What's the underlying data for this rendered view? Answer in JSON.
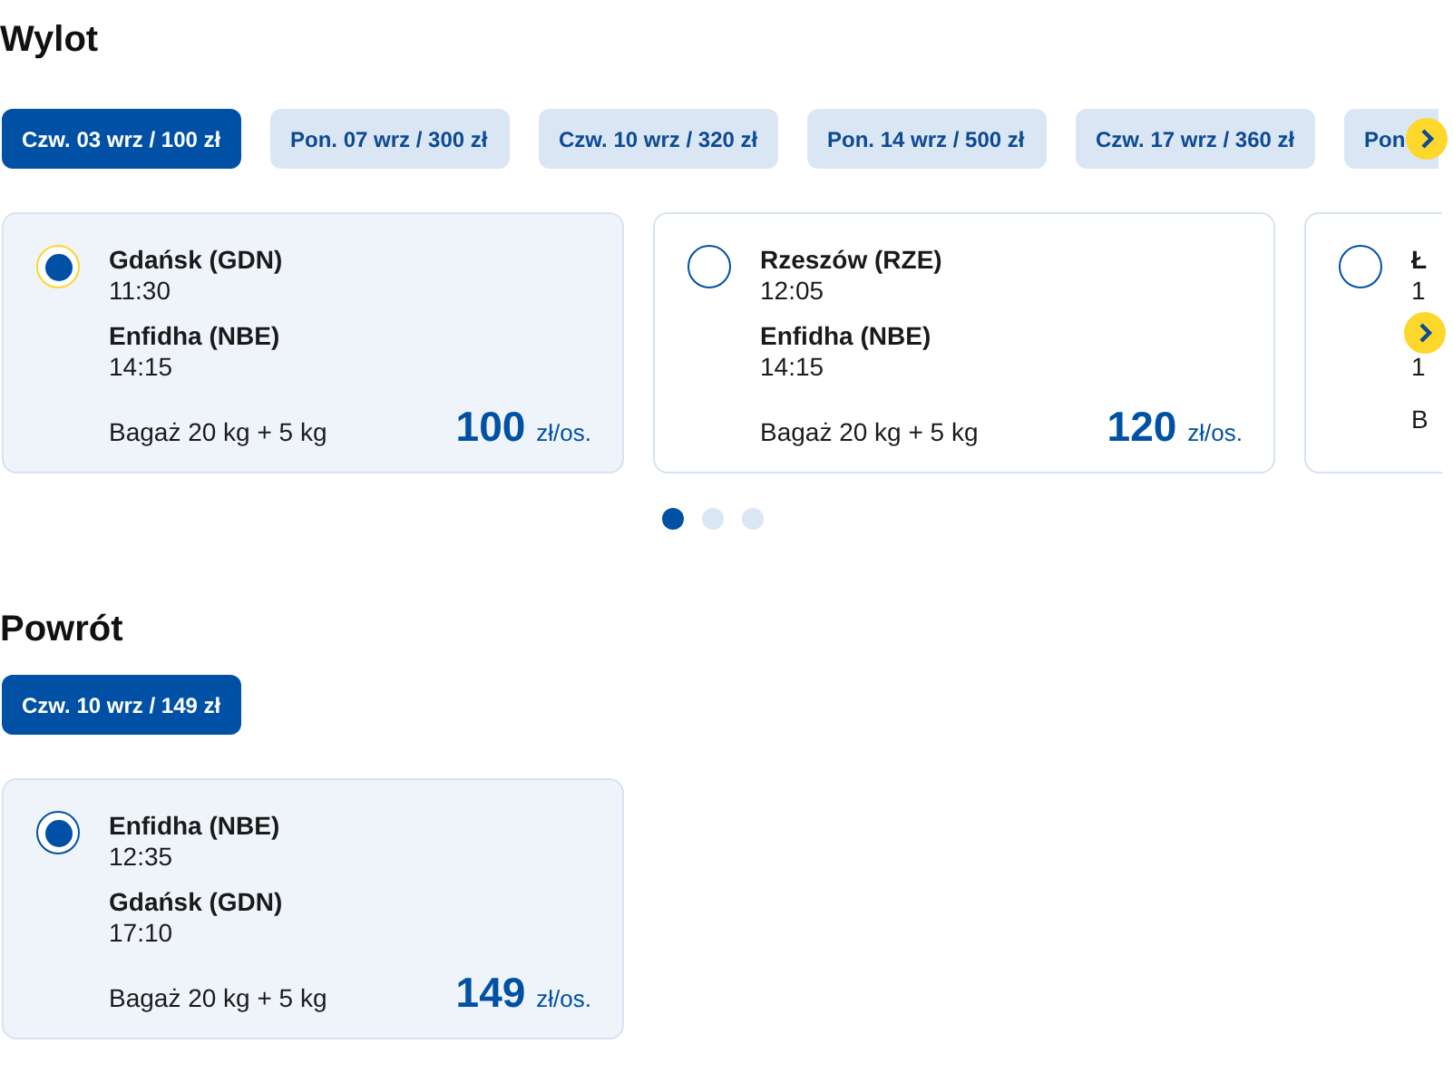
{
  "outbound": {
    "title": "Wylot",
    "dates": [
      {
        "label": "Czw. 03 wrz / 100 zł",
        "selected": true
      },
      {
        "label": "Pon. 07 wrz / 300 zł",
        "selected": false
      },
      {
        "label": "Czw. 10 wrz / 320 zł",
        "selected": false
      },
      {
        "label": "Pon. 14 wrz / 500 zł",
        "selected": false
      },
      {
        "label": "Czw. 17 wrz / 360 zł",
        "selected": false
      },
      {
        "label": "Pon",
        "selected": false
      }
    ],
    "flights": [
      {
        "from": "Gdańsk (GDN)",
        "dep": "11:30",
        "to": "Enfidha (NBE)",
        "arr": "14:15",
        "baggage": "Bagaż 20 kg + 5 kg",
        "price": "100",
        "unit": "zł/os.",
        "selected": true,
        "focused": true
      },
      {
        "from": "Rzeszów (RZE)",
        "dep": "12:05",
        "to": "Enfidha (NBE)",
        "arr": "14:15",
        "baggage": "Bagaż 20 kg + 5 kg",
        "price": "120",
        "unit": "zł/os.",
        "selected": false,
        "focused": false
      },
      {
        "from": "Ł",
        "dep": "1",
        "arr": "1",
        "baggage": "B",
        "selected": false,
        "focused": false
      }
    ],
    "pages": [
      {
        "selected": true
      },
      {
        "selected": false
      },
      {
        "selected": false
      }
    ]
  },
  "return": {
    "title": "Powrót",
    "dates": [
      {
        "label": "Czw. 10 wrz / 149 zł",
        "selected": true
      }
    ],
    "flights": [
      {
        "from": "Enfidha (NBE)",
        "dep": "12:35",
        "to": "Gdańsk (GDN)",
        "arr": "17:10",
        "baggage": "Bagaż 20 kg + 5 kg",
        "price": "149",
        "unit": "zł/os.",
        "selected": true,
        "focused": false
      }
    ]
  }
}
